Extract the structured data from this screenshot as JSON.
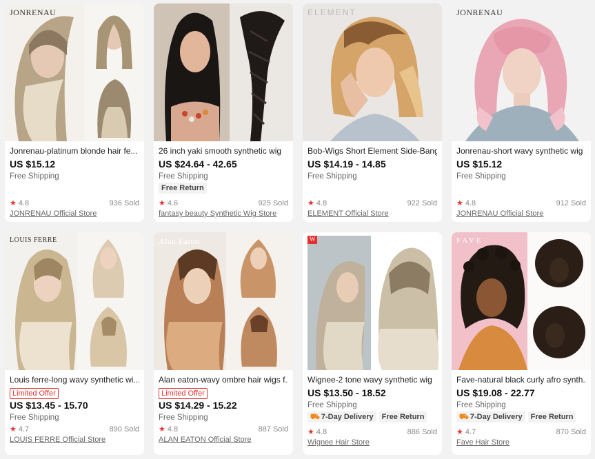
{
  "products": [
    {
      "brand_mark": "JONRENAU",
      "title": "Jonrenau-platinum blonde hair fe...",
      "offer": "",
      "price": "US $15.12",
      "shipping": "Free Shipping",
      "badges": [],
      "rating": "4.8",
      "sold": "936 Sold",
      "store": "JONRENAU Official Store",
      "hair_color": "#b8a588",
      "hair_tip": "#e6dcc8",
      "bg": "#f4f1ec"
    },
    {
      "brand_mark": "",
      "title": "26 inch yaki smooth synthetic wig",
      "offer": "",
      "price": "US $24.64 - 42.65",
      "shipping": "Free Shipping",
      "badges": [
        "Free Return"
      ],
      "rating": "4.6",
      "sold": "925 Sold",
      "store": "fantasy beauty Synthetic Wig Store",
      "hair_color": "#1a1614",
      "hair_tip": "#2c2622",
      "bg": "#d8d0c8"
    },
    {
      "brand_mark": "ELEMENT",
      "title": "Bob-Wigs Short Element Side-Bang...",
      "offer": "",
      "price": "US $14.19 - 14.85",
      "shipping": "Free Shipping",
      "badges": [],
      "rating": "4.8",
      "sold": "922 Sold",
      "store": "ELEMENT Official Store",
      "hair_color": "#d5a468",
      "hair_tip": "#e8c48c",
      "bg": "#e9e6e4"
    },
    {
      "brand_mark": "JONRENAU",
      "title": "Jonrenau-short wavy synthetic wig ...",
      "offer": "",
      "price": "US $15.12",
      "shipping": "Free Shipping",
      "badges": [],
      "rating": "4.8",
      "sold": "912 Sold",
      "store": "JONRENAU Official Store",
      "hair_color": "#e9a6b4",
      "hair_tip": "#f2c2cc",
      "bg": "#f2f2f2"
    },
    {
      "brand_mark": "LOUIS FERRE",
      "title": "Louis ferre-long wavy synthetic wi...",
      "offer": "Limited Offer",
      "price": "US $13.45 - 15.70",
      "shipping": "Free Shipping",
      "badges": [],
      "rating": "4.7",
      "sold": "890 Sold",
      "store": "LOUIS FERRE Official Store",
      "hair_color": "#cbb692",
      "hair_tip": "#ece2cf",
      "bg": "#f3f1ee"
    },
    {
      "brand_mark": "Alan Eaton",
      "title": "Alan eaton-wavy ombre hair wigs f...",
      "offer": "Limited Offer",
      "price": "US $14.29 - 15.22",
      "shipping": "Free Shipping",
      "badges": [],
      "rating": "4.8",
      "sold": "887 Sold",
      "store": "ALAN EATON Official Store",
      "hair_color": "#b98058",
      "hair_tip": "#dcab80",
      "bg": "#efe9e3"
    },
    {
      "brand_mark": "W",
      "title": "Wignee-2 tone wavy synthetic wig",
      "offer": "",
      "price": "US $13.50 - 18.52",
      "shipping": "Free Shipping",
      "badges": [
        "7-Day Delivery",
        "Free Return"
      ],
      "rating": "4.8",
      "sold": "886 Sold",
      "store": "Wignee Hair Store",
      "hair_color": "#bfb19c",
      "hair_tip": "#e2d8c6",
      "bg": "#e6e0da"
    },
    {
      "brand_mark": "FAVE",
      "title": "Fave-natural black curly afro synth...",
      "offer": "",
      "price": "US $19.08 - 22.77",
      "shipping": "Free Shipping",
      "badges": [
        "7-Day Delivery",
        "Free Return"
      ],
      "rating": "4.7",
      "sold": "870 Sold",
      "store": "Fave Hair Store",
      "hair_color": "#241a14",
      "hair_tip": "#3a2a1e",
      "bg": "#f2c0c8"
    }
  ]
}
